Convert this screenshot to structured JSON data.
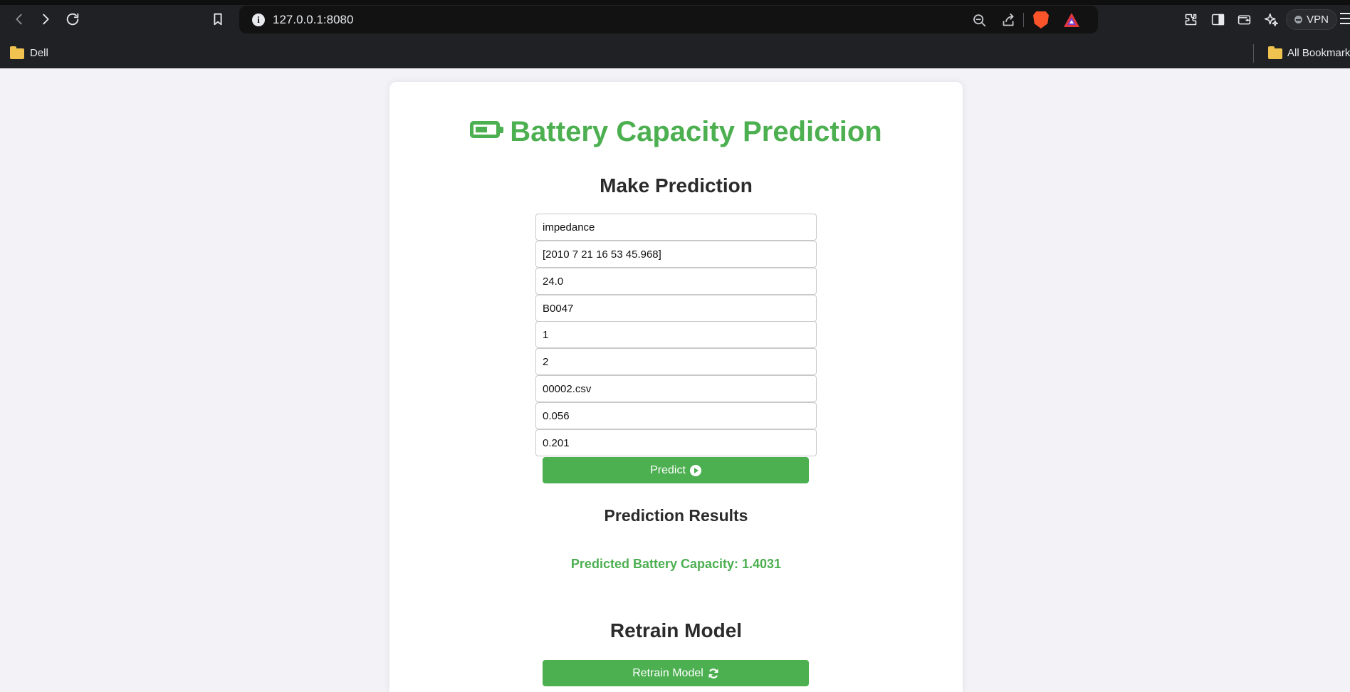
{
  "browser": {
    "url": "127.0.0.1:8080",
    "vpn_label": "VPN",
    "bookmarks": [
      {
        "label": "Dell"
      }
    ],
    "all_bookmarks_label": "All Bookmarks"
  },
  "page": {
    "title": "Battery Capacity Prediction",
    "make_prediction_heading": "Make Prediction",
    "inputs": [
      {
        "value": "impedance"
      },
      {
        "value": "[2010 7 21 16 53 45.968]"
      },
      {
        "value": "24.0"
      },
      {
        "value": "B0047"
      },
      {
        "value": "1"
      },
      {
        "value": "2"
      },
      {
        "value": "00002.csv"
      },
      {
        "value": "0.056"
      },
      {
        "value": "0.201"
      }
    ],
    "predict_button": "Predict",
    "results_heading": "Prediction Results",
    "result_text": "Predicted Battery Capacity: 1.4031",
    "retrain_heading": "Retrain Model",
    "retrain_button": "Retrain Model"
  },
  "colors": {
    "accent": "#4caf50",
    "page_bg": "#f2f2f7",
    "chrome_bg": "#202124"
  }
}
